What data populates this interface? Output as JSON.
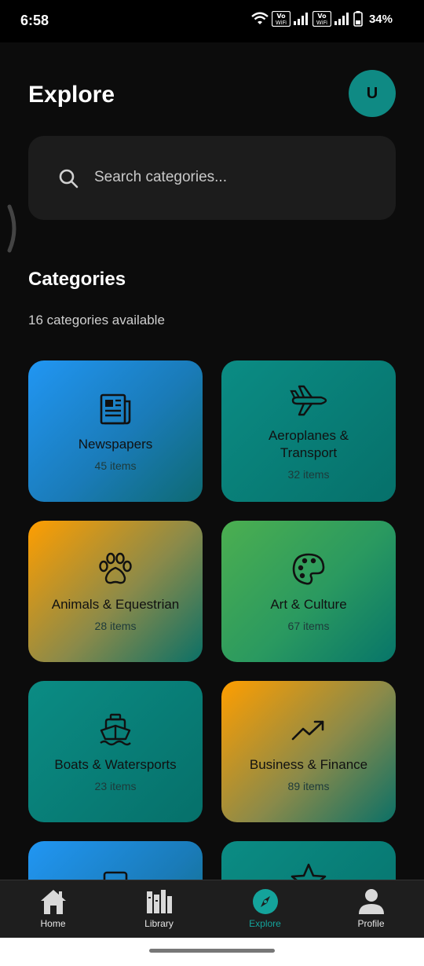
{
  "status_bar": {
    "time": "6:58",
    "battery": "34%",
    "vowifi_1": "Vo\nWiFi",
    "vowifi_2": "Vo\nWiFi"
  },
  "header": {
    "title": "Explore",
    "avatar_initial": "U"
  },
  "search": {
    "placeholder": "Search categories..."
  },
  "section": {
    "title": "Categories",
    "subtitle": "16 categories available"
  },
  "categories": [
    {
      "name": "Newspapers",
      "count": "45 items",
      "icon": "newspaper-icon",
      "gradient": "blue"
    },
    {
      "name": "Aeroplanes &\nTransport",
      "count": "32 items",
      "icon": "airplane-icon",
      "gradient": "teal"
    },
    {
      "name": "Animals & Equestrian",
      "count": "28 items",
      "icon": "paw-icon",
      "gradient": "orange"
    },
    {
      "name": "Art & Culture",
      "count": "67 items",
      "icon": "palette-icon",
      "gradient": "green"
    },
    {
      "name": "Boats & Watersports",
      "count": "23 items",
      "icon": "ship-icon",
      "gradient": "teal"
    },
    {
      "name": "Business & Finance",
      "count": "89 items",
      "icon": "trending-up-icon",
      "gradient": "orange"
    },
    {
      "name": "",
      "count": "",
      "icon": "document-icon",
      "gradient": "blue"
    },
    {
      "name": "",
      "count": "",
      "icon": "star-icon",
      "gradient": "teal"
    }
  ],
  "bottom_nav": {
    "items": [
      {
        "label": "Home",
        "icon": "home-icon"
      },
      {
        "label": "Library",
        "icon": "library-icon"
      },
      {
        "label": "Explore",
        "icon": "compass-icon",
        "active": true
      },
      {
        "label": "Profile",
        "icon": "person-icon"
      }
    ]
  },
  "colors": {
    "accent": "#14a39b",
    "background": "#0c0c0c",
    "search_bg": "#1c1c1c"
  }
}
